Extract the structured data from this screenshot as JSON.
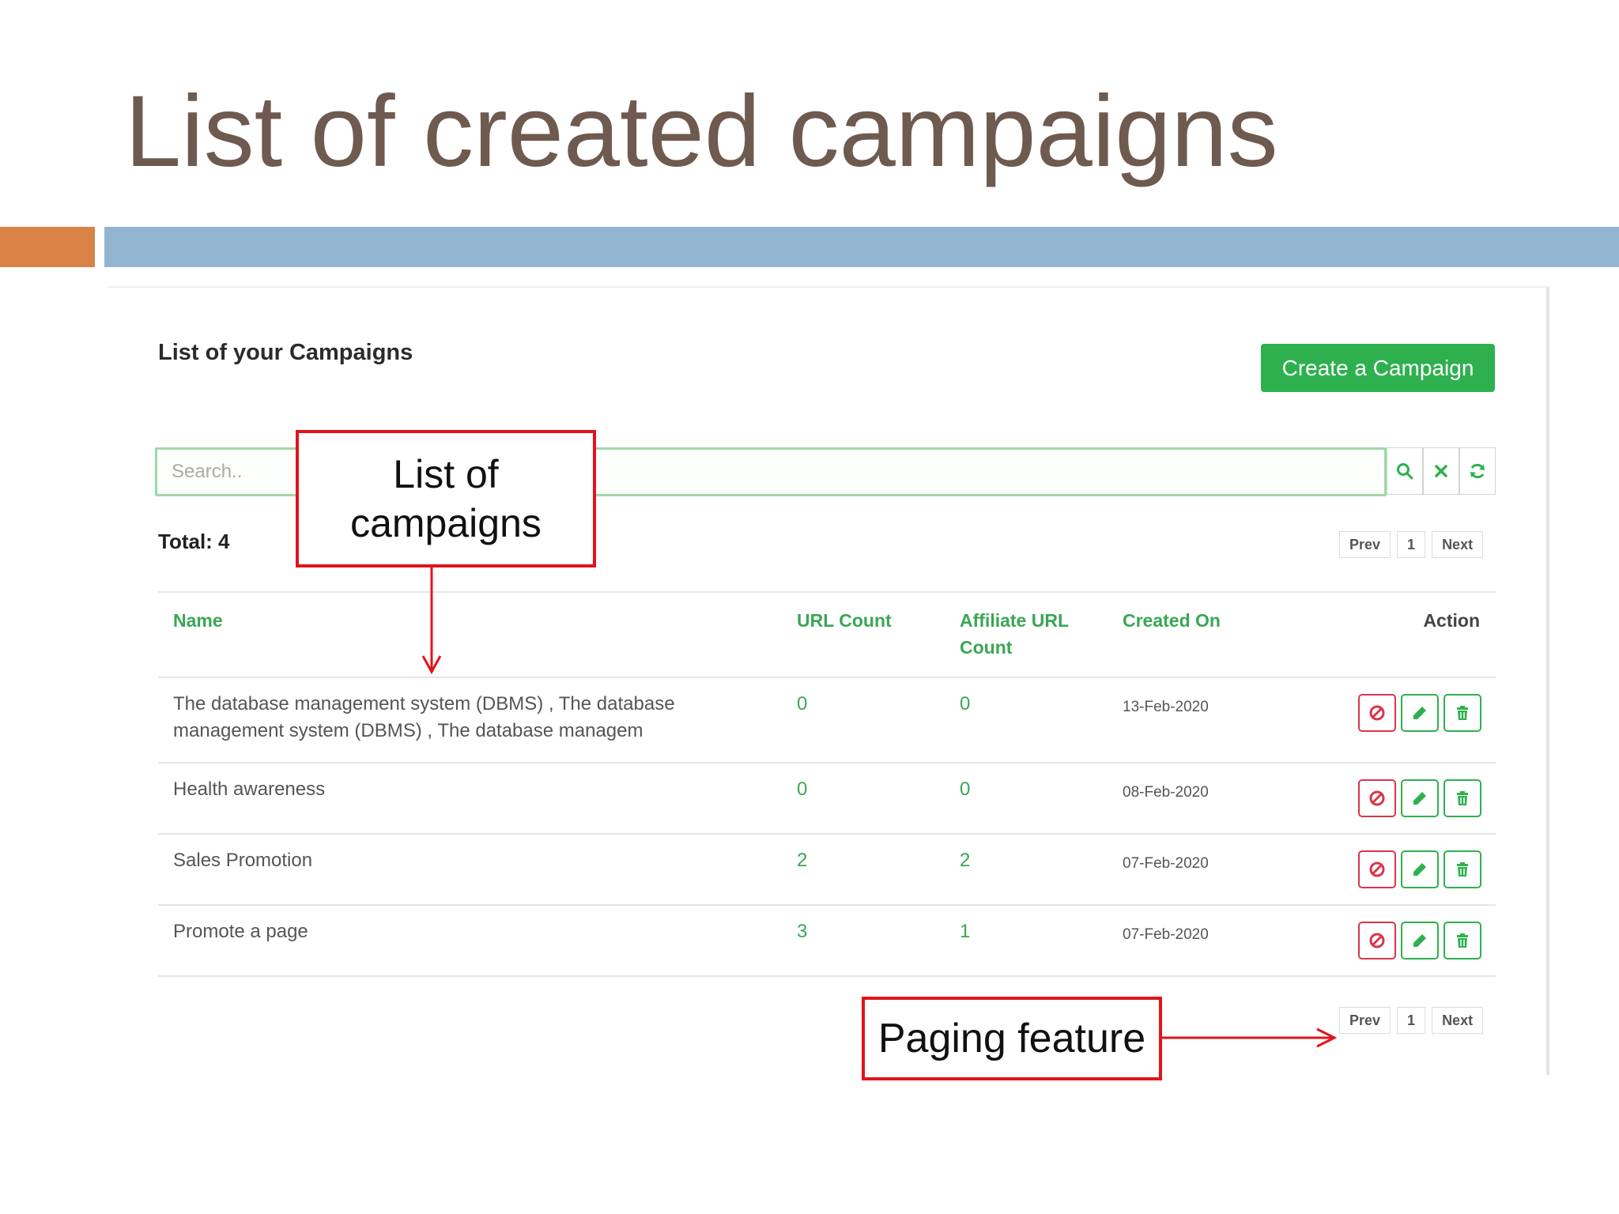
{
  "slide": {
    "title": "List of created campaigns"
  },
  "panel": {
    "heading": "List of your Campaigns",
    "create_button": "Create a Campaign",
    "search": {
      "placeholder": "Search.."
    },
    "total_label": "Total: 4",
    "pager": {
      "prev": "Prev",
      "page": "1",
      "next": "Next"
    },
    "table": {
      "columns": [
        "Name",
        "URL Count",
        "Affiliate URL Count",
        "Created On",
        "Action"
      ],
      "rows": [
        {
          "name": "The database management system (DBMS) , The database management system (DBMS) , The database managem",
          "url_count": "0",
          "affiliate_url_count": "0",
          "created_on": "13-Feb-2020"
        },
        {
          "name": "Health awareness",
          "url_count": "0",
          "affiliate_url_count": "0",
          "created_on": "08-Feb-2020"
        },
        {
          "name": "Sales Promotion",
          "url_count": "2",
          "affiliate_url_count": "2",
          "created_on": "07-Feb-2020"
        },
        {
          "name": "Promote a page",
          "url_count": "3",
          "affiliate_url_count": "1",
          "created_on": "07-Feb-2020"
        }
      ]
    }
  },
  "annotations": {
    "list_callout": [
      "List of",
      "campaigns"
    ],
    "paging_callout": "Paging feature"
  },
  "colors": {
    "title": "#6e5a4e",
    "orange_bar": "#d98347",
    "blue_bar": "#93b5cf",
    "accent_green": "#2fb04f",
    "danger_red": "#d9364a",
    "callout_red": "#e1141c"
  },
  "icons": [
    "search-icon",
    "clear-icon",
    "refresh-icon",
    "block-icon",
    "edit-icon",
    "trash-icon",
    "arrow-icon"
  ]
}
